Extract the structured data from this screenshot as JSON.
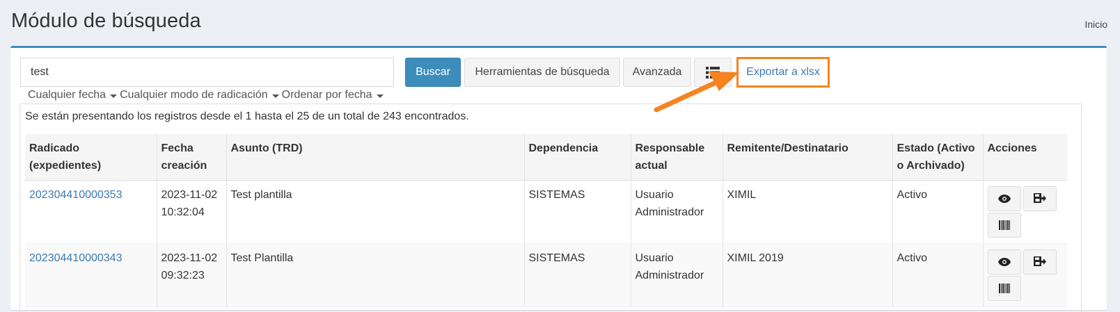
{
  "header": {
    "title": "Módulo de búsqueda",
    "breadcrumb": "Inicio"
  },
  "search": {
    "value": "test",
    "button_label": "Buscar",
    "tools_label": "Herramientas de búsqueda",
    "advanced_label": "Avanzada",
    "list_icon": "list-icon",
    "export_label": "Exportar a xlsx"
  },
  "filters": [
    "Cualquier fecha",
    "Cualquier modo de radicación",
    "Ordenar por fecha"
  ],
  "results": {
    "summary": "Se están presentando los registros desde el 1 hasta el 25 de un total de 243 encontrados.",
    "columns": {
      "radicado": [
        "Radicado",
        "(expedientes)"
      ],
      "fecha": [
        "Fecha",
        "creación"
      ],
      "asunto": "Asunto (TRD)",
      "dependencia": "Dependencia",
      "responsable": [
        "Responsable",
        "actual"
      ],
      "remitente": "Remitente/Destinatario",
      "estado": [
        "Estado (Activo",
        "o Archivado)"
      ],
      "acciones": "Acciones"
    },
    "rows": [
      {
        "radicado": "202304410000353",
        "fecha": "2023-11-02",
        "hora": "10:32:04",
        "asunto": "Test plantilla",
        "dependencia": "SISTEMAS",
        "responsable_1": "Usuario",
        "responsable_2": "Administrador",
        "remitente": "XIMIL",
        "estado": "Activo"
      },
      {
        "radicado": "202304410000343",
        "fecha": "2023-11-02",
        "hora": "09:32:23",
        "asunto": "Test Plantilla",
        "dependencia": "SISTEMAS",
        "responsable_1": "Usuario",
        "responsable_2": "Administrador",
        "remitente": "XIMIL 2019",
        "estado": "Activo"
      }
    ]
  },
  "colors": {
    "primary": "#3c8dbc",
    "highlight": "#f5831f",
    "link": "#3c7ab4"
  }
}
